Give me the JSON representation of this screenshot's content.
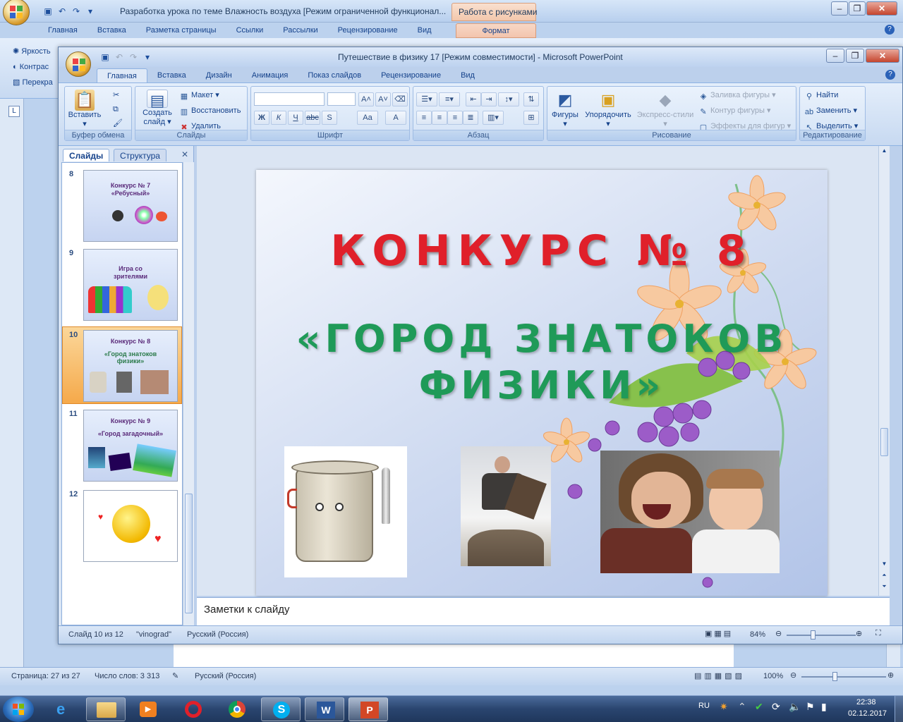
{
  "word": {
    "title": "Разработка урока по теме Влажность воздуха [Режим ограниченной функционал...",
    "context_group": "Работа с рисунками",
    "tabs": [
      "Главная",
      "Вставка",
      "Разметка страницы",
      "Ссылки",
      "Рассылки",
      "Рецензирование",
      "Вид"
    ],
    "context_tab": "Формат",
    "side_items": [
      "Яркость",
      "Контрас",
      "Перекра"
    ],
    "status": {
      "page": "Страница: 27 из 27",
      "words": "Число слов: 3 313",
      "lang": "Русский (Россия)",
      "zoom": "100%"
    }
  },
  "ppt": {
    "title": "Путешествие  в физику 17 [Режим совместимости] - Microsoft PowerPoint",
    "tabs": [
      "Главная",
      "Вставка",
      "Дизайн",
      "Анимация",
      "Показ слайдов",
      "Рецензирование",
      "Вид"
    ],
    "active_tab": "Главная",
    "ribbon": {
      "clipboard": {
        "label": "Буфер обмена",
        "paste": "Вставить"
      },
      "slides": {
        "label": "Слайды",
        "new_slide_1": "Создать",
        "new_slide_2": "слайд",
        "layout": "Макет",
        "reset": "Восстановить",
        "delete": "Удалить"
      },
      "font": {
        "label": "Шрифт",
        "buttons": [
          "Ж",
          "К",
          "Ч",
          "abc",
          "S",
          "Aa",
          "A"
        ]
      },
      "paragraph": {
        "label": "Абзац"
      },
      "drawing": {
        "label": "Рисование",
        "shapes": "Фигуры",
        "arrange": "Упорядочить",
        "quick_styles": "Экспресс-стили",
        "fill": "Заливка фигуры",
        "outline": "Контур фигуры",
        "effects": "Эффекты для фигур"
      },
      "editing": {
        "label": "Редактирование",
        "find": "Найти",
        "replace": "Заменить",
        "select": "Выделить"
      }
    },
    "panel": {
      "tab_slides": "Слайды",
      "tab_outline": "Структура"
    },
    "thumbs": [
      {
        "num": "8",
        "line1": "Конкурс № 7",
        "line2": "«Ребусный»"
      },
      {
        "num": "9",
        "line1": "Игра со",
        "line2": "зрителями"
      },
      {
        "num": "10",
        "line1": "Конкурс № 8",
        "line2": "«Город знатоков",
        "line3": "физики»"
      },
      {
        "num": "11",
        "line1": "Конкурс № 9",
        "line2": "«Город загадочный»"
      },
      {
        "num": "12"
      }
    ],
    "slide": {
      "title": "КОНКУРС № 8",
      "subtitle_1": "«ГОРОД ЗНАТОКОВ",
      "subtitle_2": "ФИЗИКИ»"
    },
    "notes": "Заметки к слайду",
    "status": {
      "slide": "Слайд 10 из 12",
      "theme": "\"vinograd\"",
      "lang": "Русский (Россия)",
      "zoom": "84%"
    },
    "colors": {
      "title": "#e0202a",
      "subtitle": "#1f9a58",
      "accent": "#f5a13a"
    }
  },
  "taskbar": {
    "lang": "RU",
    "time": "22:38",
    "date": "02.12.2017"
  }
}
